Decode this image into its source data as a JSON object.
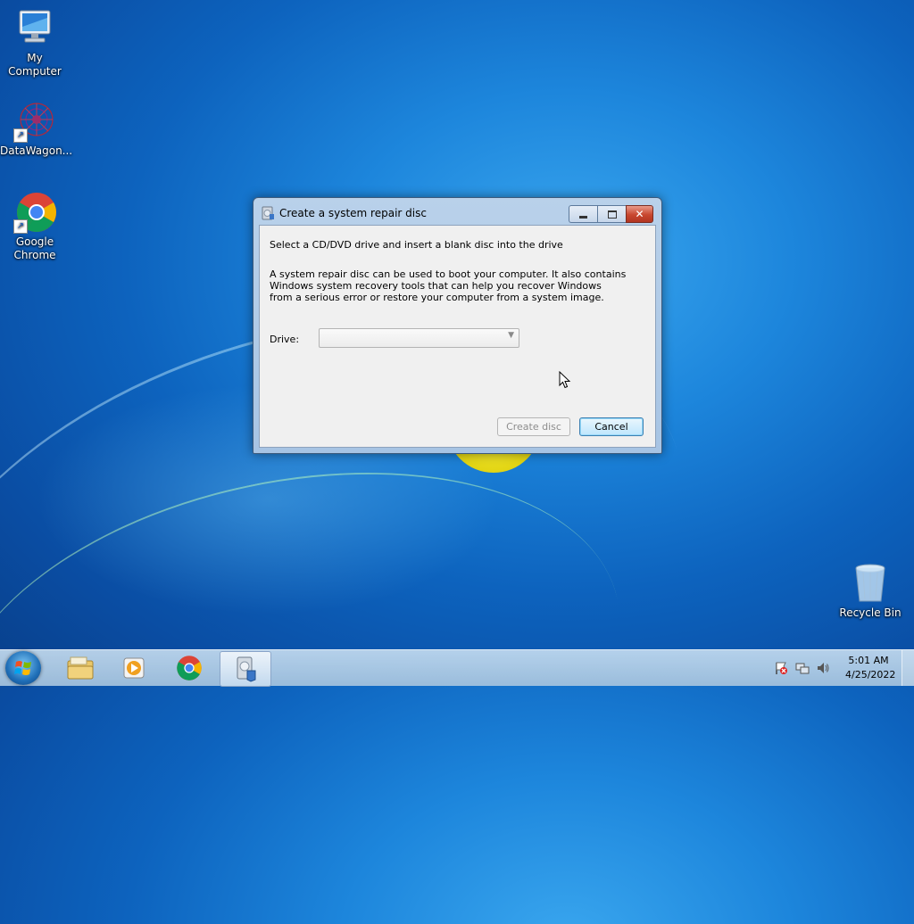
{
  "desktop": {
    "icons": [
      {
        "label": "My Computer",
        "icon": "computer-icon",
        "shortcut": false
      },
      {
        "label": "DataWagon...",
        "icon": "datawagon-icon",
        "shortcut": true
      },
      {
        "label": "Google Chrome",
        "icon": "chrome-icon",
        "shortcut": true
      },
      {
        "label": "Recycle Bin",
        "icon": "recycle-bin-icon",
        "shortcut": false
      }
    ]
  },
  "dialog": {
    "title": "Create a system repair disc",
    "heading": "Select a CD/DVD drive and insert a blank disc into the drive",
    "description": "A system repair disc can be used to boot your computer. It also contains Windows system recovery tools that can help you recover Windows from a serious error or restore your computer from a system image.",
    "drive_label": "Drive:",
    "drive_value": "",
    "create_button": "Create disc",
    "cancel_button": "Cancel",
    "create_enabled": false
  },
  "taskbar": {
    "items": [
      {
        "name": "windows-explorer-icon"
      },
      {
        "name": "media-player-icon"
      },
      {
        "name": "chrome-icon"
      },
      {
        "name": "repair-disc-app-icon",
        "active": true
      }
    ],
    "clock": {
      "time": "5:01 AM",
      "date": "4/25/2022"
    }
  },
  "colors": {
    "desktop_blue": "#1d86dc",
    "close_button_red": "#c8472f",
    "focus_button_blue": "#3c7fb1"
  }
}
